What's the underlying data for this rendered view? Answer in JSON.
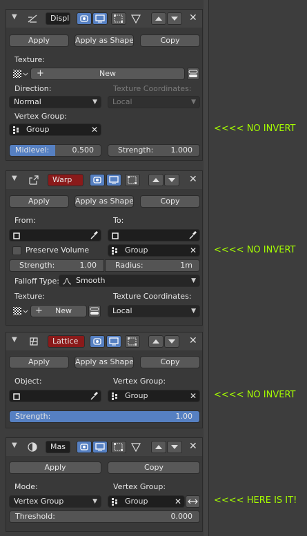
{
  "annotations": [
    "<<<< NO INVERT",
    "<<<< NO INVERT",
    "<<<< NO INVERT",
    "<<<< HERE IS  IT!"
  ],
  "common": {
    "apply": "Apply",
    "apply_as_shape": "Apply as Shape..",
    "copy": "Copy"
  },
  "displace": {
    "name": "Displ",
    "texture_label": "Texture:",
    "new_label": "New",
    "direction_label": "Direction:",
    "direction_value": "Normal",
    "tex_coords_label": "Texture Coordinates:",
    "tex_coords_value": "Local",
    "vgroup_label": "Vertex Group:",
    "vgroup_value": "Group",
    "midlevel_label": "Midlevel:",
    "midlevel_value": "0.500",
    "strength_label": "Strength:",
    "strength_value": "1.000"
  },
  "warp": {
    "name": "Warp",
    "from_label": "From:",
    "to_label": "To:",
    "preserve_volume": "Preserve Volume",
    "vgroup_value": "Group",
    "strength_label": "Strength:",
    "strength_value": "1.00",
    "radius_label": "Radius:",
    "radius_value": "1m",
    "falloff_label": "Falloff Type:",
    "falloff_value": "Smooth",
    "texture_label": "Texture:",
    "new_label": "New",
    "tex_coords_label": "Texture Coordinates:",
    "tex_coords_value": "Local"
  },
  "lattice": {
    "name": "Lattice",
    "object_label": "Object:",
    "vgroup_label": "Vertex Group:",
    "vgroup_value": "Group",
    "strength_label": "Strength:",
    "strength_value": "1.00"
  },
  "mask": {
    "name": "Mas",
    "mode_label": "Mode:",
    "mode_value": "Vertex Group",
    "vgroup_label": "Vertex Group:",
    "vgroup_value": "Group",
    "threshold_label": "Threshold:",
    "threshold_value": "0.000"
  },
  "colors": {
    "accent": "#5680c2",
    "annotation": "#a6ff00",
    "red_name": "#8a1a1a"
  }
}
